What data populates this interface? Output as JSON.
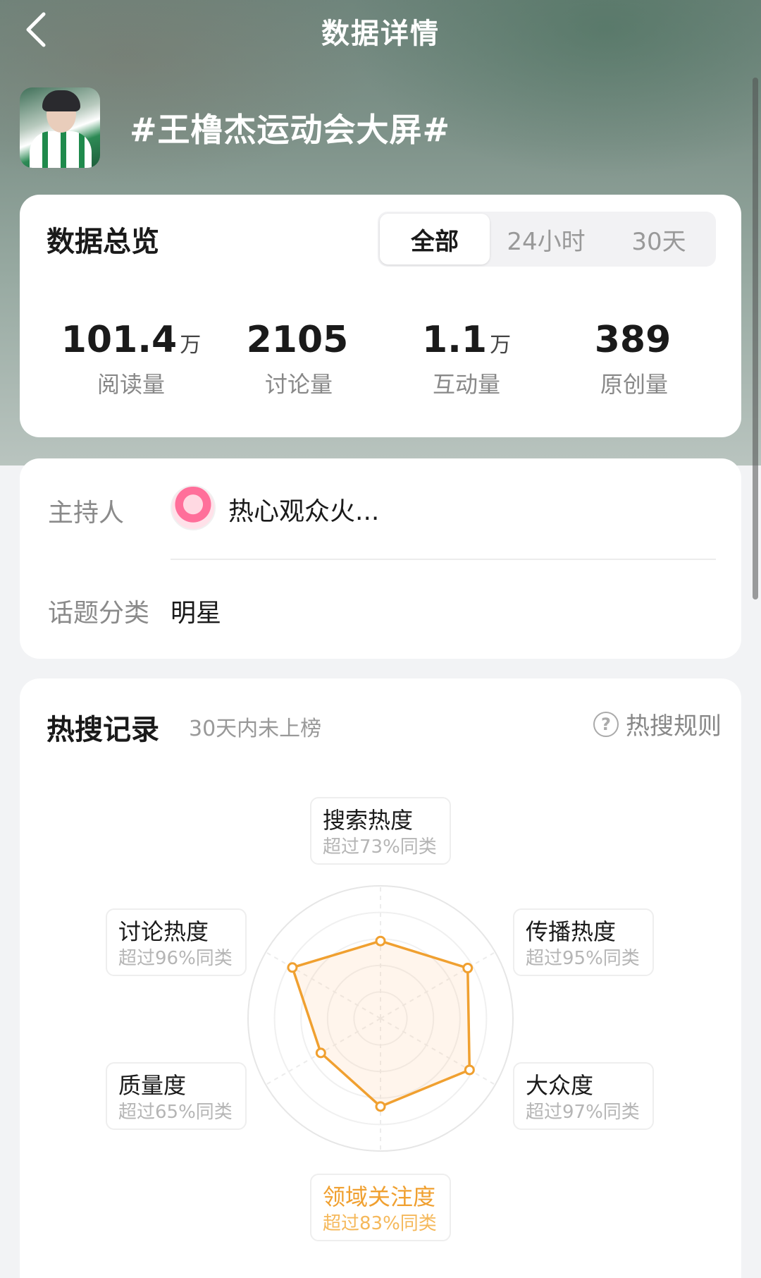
{
  "header": {
    "title": "数据详情",
    "back_icon": "chevron-left-icon"
  },
  "topic": {
    "title": "#王橹杰运动会大屏#"
  },
  "overview": {
    "title": "数据总览",
    "tabs": [
      {
        "label": "全部",
        "active": true
      },
      {
        "label": "24小时",
        "active": false
      },
      {
        "label": "30天",
        "active": false
      }
    ],
    "stats": [
      {
        "value": "101.4",
        "unit": "万",
        "label": "阅读量"
      },
      {
        "value": "2105",
        "unit": "",
        "label": "讨论量"
      },
      {
        "value": "1.1",
        "unit": "万",
        "label": "互动量"
      },
      {
        "value": "389",
        "unit": "",
        "label": "原创量"
      }
    ]
  },
  "info": {
    "host_label": "主持人",
    "host_name": "热心观众火...",
    "category_label": "话题分类",
    "category_value": "明星"
  },
  "hot_search": {
    "title": "热搜记录",
    "subtitle": "30天内未上榜",
    "rule_link": "热搜规则",
    "rule_icon": "help-circle-icon",
    "accent_color": "#f0a030",
    "dimensions": [
      {
        "name": "搜索热度",
        "note": "超过73%同类",
        "percent": 73
      },
      {
        "name": "传播热度",
        "note": "超过95%同类",
        "percent": 95
      },
      {
        "name": "大众度",
        "note": "超过97%同类",
        "percent": 97
      },
      {
        "name": "领域关注度",
        "note": "超过83%同类",
        "percent": 83,
        "highlighted": true
      },
      {
        "name": "质量度",
        "note": "超过65%同类",
        "percent": 65
      },
      {
        "name": "讨论热度",
        "note": "超过96%同类",
        "percent": 96
      }
    ]
  }
}
